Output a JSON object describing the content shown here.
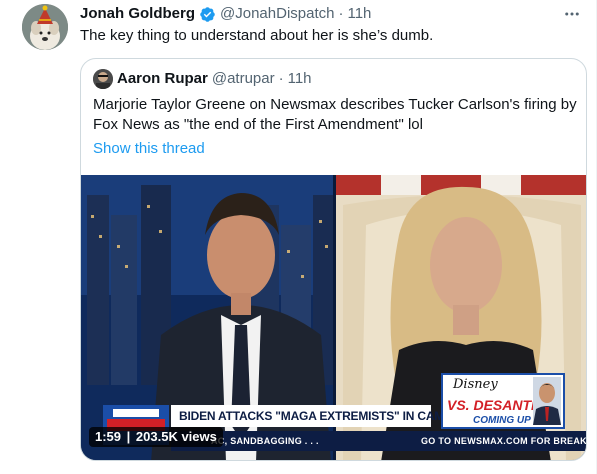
{
  "tweet": {
    "author_name": "Jonah Goldberg",
    "handle": "@JonahDispatch",
    "separator": "·",
    "time": "11h",
    "text": "The key thing to understand about her is she’s dumb.",
    "more_icon": "ellipsis-icon",
    "verified_icon": "verified-badge-icon"
  },
  "quote": {
    "author_name": "Aaron Rupar",
    "handle": "@atrupar",
    "separator": "·",
    "time": "11h",
    "text": "Marjorie Taylor Greene on Newsmax describes Tucker Carlson's firing by Fox News as \"the end of the First Amendment\" lol",
    "show_thread": "Show this thread",
    "video": {
      "duration": "1:59",
      "views": "203.5K views",
      "chyron_headline": "BIDEN ATTACKS \"MAGA EXTREMISTS\" IN CAMPAIGN AD",
      "ticker_left": "AC, SANDBAGGING . . .",
      "ticker_right": "GO TO NEWSMAX.COM FOR BREAKING NEWS . . .",
      "promo_brand": "Disney",
      "promo_title": "VS. DESANTIS",
      "promo_sub": "COMING UP"
    }
  },
  "colors": {
    "link_blue": "#1d9bf0",
    "secondary_text": "#536471",
    "border": "#cfd9de",
    "newsmax_navy": "#0d1d44"
  }
}
